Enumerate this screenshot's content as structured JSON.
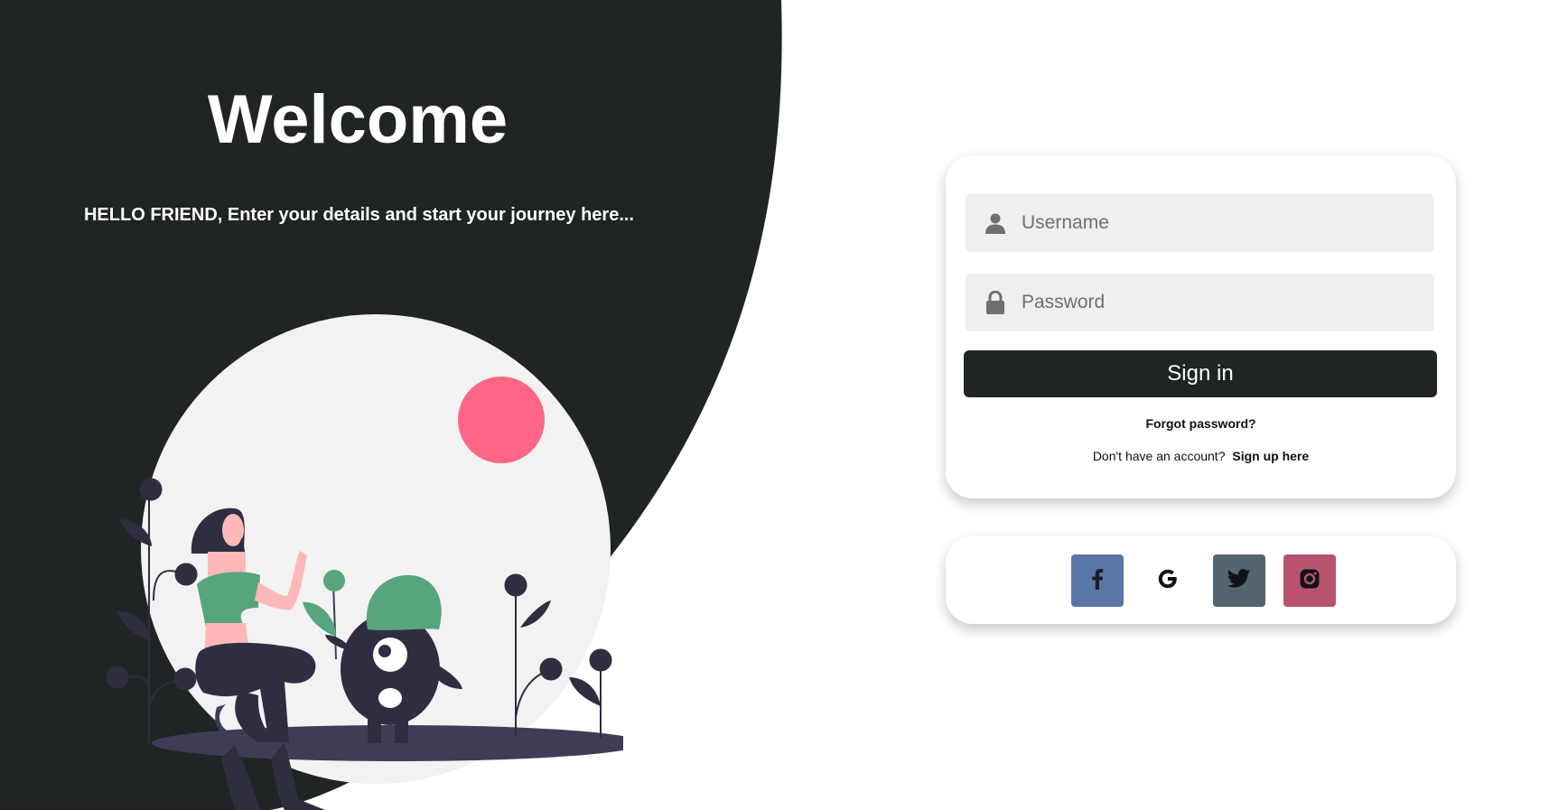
{
  "hero": {
    "title": "Welcome",
    "subtitle": "HELLO FRIEND, Enter your details and start your journey here..."
  },
  "login": {
    "username_placeholder": "Username",
    "password_placeholder": "Password",
    "signin_label": "Sign in",
    "forgot_label": "Forgot password?",
    "no_account_text": "Don't have an account?",
    "signup_label": "Sign up here"
  },
  "social": {
    "buttons": [
      {
        "name": "facebook",
        "icon": "facebook-icon",
        "color": "#5b75a8"
      },
      {
        "name": "google",
        "icon": "google-icon",
        "color": "#ffffff"
      },
      {
        "name": "twitter",
        "icon": "twitter-icon",
        "color": "#536570"
      },
      {
        "name": "instagram",
        "icon": "instagram-icon",
        "color": "#b8546e"
      }
    ]
  },
  "colors": {
    "dark_panel": "#212424",
    "accent_sun": "#ff6584",
    "plant_green": "#57a57d",
    "figure_dark": "#2f2e41"
  }
}
